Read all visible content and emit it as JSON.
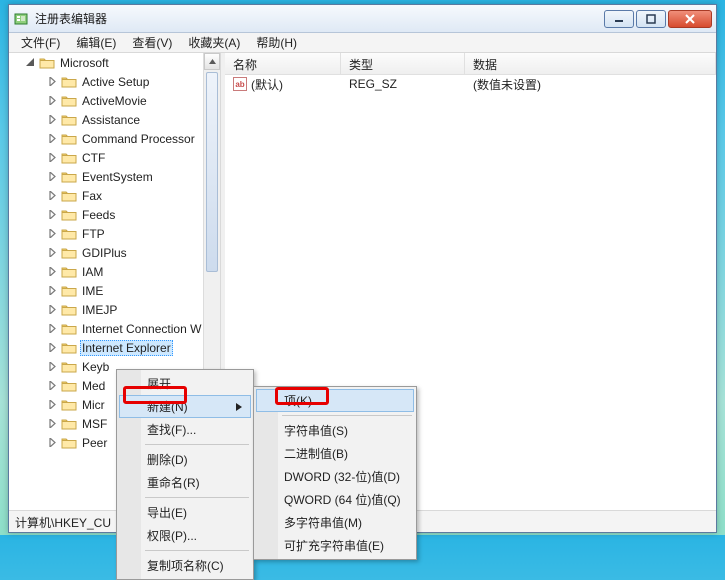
{
  "window": {
    "title": "注册表编辑器"
  },
  "menubar": {
    "file": "文件(F)",
    "edit": "编辑(E)",
    "view": "查看(V)",
    "favorites": "收藏夹(A)",
    "help": "帮助(H)"
  },
  "tree": {
    "root": "Microsoft",
    "items": [
      "Active Setup",
      "ActiveMovie",
      "Assistance",
      "Command Processor",
      "CTF",
      "EventSystem",
      "Fax",
      "Feeds",
      "FTP",
      "GDIPlus",
      "IAM",
      "IME",
      "IMEJP",
      "Internet Connection W",
      "Internet Explorer",
      "Keyb",
      "Med",
      "Micr",
      "MSF",
      "Peer"
    ],
    "selectedIndex": 14
  },
  "list": {
    "columns": {
      "name": "名称",
      "type": "类型",
      "data": "数据"
    },
    "rows": [
      {
        "icon": "ab",
        "name": "(默认)",
        "type": "REG_SZ",
        "data": "(数值未设置)"
      }
    ]
  },
  "statusbar": {
    "path": "计算机\\HKEY_CU"
  },
  "context_main": {
    "expand": "展开",
    "new": "新建(N)",
    "find": "查找(F)...",
    "delete": "删除(D)",
    "rename": "重命名(R)",
    "export": "导出(E)",
    "permissions": "权限(P)...",
    "copykey": "复制项名称(C)"
  },
  "context_new": {
    "key": "项(K)",
    "string": "字符串值(S)",
    "binary": "二进制值(B)",
    "dword": "DWORD (32-位)值(D)",
    "qword": "QWORD (64 位)值(Q)",
    "multistring": "多字符串值(M)",
    "expandstring": "可扩充字符串值(E)"
  },
  "colors": {
    "highlight_border": "#e60000"
  }
}
